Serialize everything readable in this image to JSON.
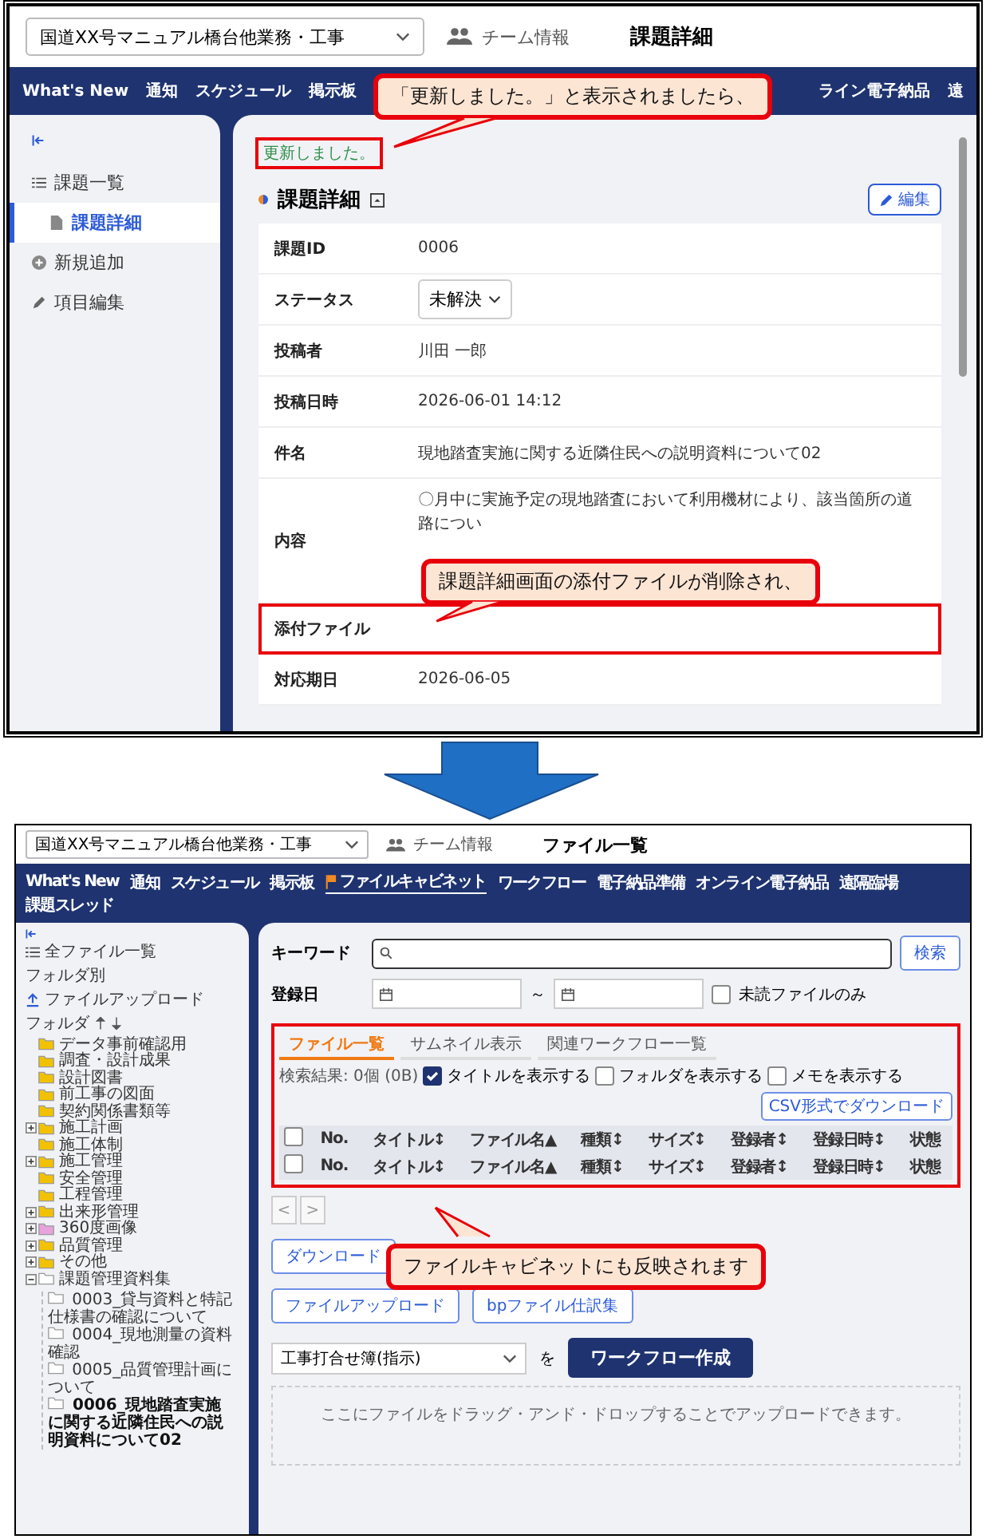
{
  "issue_screen": {
    "project_select": "国道XX号マニュアル橋台他業務・工事",
    "team_info": "チーム情報",
    "page_title": "課題詳細",
    "nav_left": [
      "What's New",
      "通知",
      "スケジュール",
      "掲示板"
    ],
    "nav_right": [
      "ライン電子納品",
      "遠"
    ],
    "sidebar_items": [
      {
        "label": "課題一覧",
        "kind": "list",
        "selected": false
      },
      {
        "label": "課題詳細",
        "kind": "doc",
        "selected": true
      },
      {
        "label": "新規追加",
        "kind": "add",
        "selected": false
      },
      {
        "label": "項目編集",
        "kind": "edit",
        "selected": false
      }
    ],
    "flash_message": "更新しました。",
    "section_title": "課題詳細",
    "edit_button": "編集",
    "fields": [
      {
        "label": "課題ID",
        "value": "0006",
        "kind": "text"
      },
      {
        "label": "ステータス",
        "value": "未解決",
        "kind": "select"
      },
      {
        "label": "投稿者",
        "value": "川田 一郎",
        "kind": "text"
      },
      {
        "label": "投稿日時",
        "value": "2026-06-01 14:12",
        "kind": "text"
      },
      {
        "label": "件名",
        "value": "現地踏査実施に関する近隣住民への説明資料について02",
        "kind": "text"
      },
      {
        "label": "内容",
        "value": "〇月中に実施予定の現地踏査において利用機材により、該当箇所の道路につい",
        "kind": "multiline"
      },
      {
        "label": "添付ファイル",
        "kind": "highlighted"
      },
      {
        "label": "対応期日",
        "value": "2026-06-05",
        "kind": "text"
      }
    ]
  },
  "callouts": [
    "「更新しました。」と表示されましたら、",
    "課題詳細画面の添付ファイルが削除され、",
    "ファイルキャビネットにも反映されます"
  ],
  "file_screen": {
    "project_select": "国道XX号マニュアル橋台他業務・工事",
    "team_info": "チーム情報",
    "page_title": "ファイル一覧",
    "nav": [
      {
        "label": "What's New",
        "selected": false
      },
      {
        "label": "通知",
        "selected": false
      },
      {
        "label": "スケジュール",
        "selected": false
      },
      {
        "label": "掲示板",
        "selected": false
      },
      {
        "label": "ファイルキャビネット",
        "selected": true
      },
      {
        "label": "ワークフロー",
        "selected": false
      },
      {
        "label": "電子納品準備",
        "selected": false
      },
      {
        "label": "オンライン電子納品",
        "selected": false
      },
      {
        "label": "遠隔臨場",
        "selected": false
      },
      {
        "label": "課題スレッド",
        "selected": false
      }
    ],
    "sidebar": {
      "all_files": "全ファイル一覧",
      "folder_heading": "フォルダ別",
      "upload": "ファイルアップロード",
      "folder_label": "フォルダ",
      "folders": [
        {
          "label": "データ事前確認用",
          "color": "#f2c200"
        },
        {
          "label": "調査・設計成果",
          "color": "#f2c200"
        },
        {
          "label": "設計図書",
          "color": "#f2c200"
        },
        {
          "label": "前工事の図面",
          "color": "#f2c200"
        },
        {
          "label": "契約関係書類等",
          "color": "#f2c200"
        },
        {
          "label": "施工計画",
          "color": "#f2c200",
          "expanded": false
        },
        {
          "label": "施工体制",
          "color": "#f2c200"
        },
        {
          "label": "施工管理",
          "color": "#f2c200",
          "expanded": false
        },
        {
          "label": "安全管理",
          "color": "#f2c200"
        },
        {
          "label": "工程管理",
          "color": "#f2c200"
        },
        {
          "label": "出来形管理",
          "color": "#f2c200",
          "expanded": false
        },
        {
          "label": "360度画像",
          "color": "#e6a3dc",
          "expanded": false
        },
        {
          "label": "品質管理",
          "color": "#f2c200",
          "expanded": false
        },
        {
          "label": "その他",
          "color": "#f2c200",
          "expanded": false
        },
        {
          "label": "課題管理資料集",
          "color": "#ffffff",
          "expanded": true,
          "children": [
            {
              "label": "0003_貸与資料と特記仕様書の確認について",
              "color": "#ffffff",
              "selected": false
            },
            {
              "label": "0004_現地測量の資料確認",
              "color": "#ffffff",
              "selected": false
            },
            {
              "label": "0005_品質管理計画について",
              "color": "#ffffff",
              "selected": false
            },
            {
              "label": "0006_現地踏査実施に関する近隣住民への説明資料について02",
              "color": "#ffffff",
              "selected": true
            }
          ]
        }
      ]
    },
    "keyword_label": "キーワード",
    "search_button": "検索",
    "date_label": "登録日",
    "range_separator": "～",
    "unread_only": {
      "label": "未読ファイルのみ",
      "checked": false
    },
    "tabs": [
      {
        "label": "ファイル一覧",
        "selected": true
      },
      {
        "label": "サムネイル表示",
        "selected": false
      },
      {
        "label": "関連ワークフロー一覧",
        "selected": false
      }
    ],
    "result_count": "検索結果: 0個 (0B)",
    "display_options": [
      {
        "label": "タイトルを表示する",
        "checked": true
      },
      {
        "label": "フォルダを表示する",
        "checked": false
      },
      {
        "label": "メモを表示する",
        "checked": false
      }
    ],
    "csv_button": "CSV形式でダウンロード",
    "table_header_rows": [
      {
        "checked": false,
        "cells": [
          "No.",
          "タイトル↕",
          "ファイル名▲",
          "種類↕",
          "サイズ↕",
          "登録者↕",
          "登録日時↕",
          "状態"
        ]
      },
      {
        "checked": false,
        "cells": [
          "No.",
          "タイトル↕",
          "ファイル名▲",
          "種類↕",
          "サイズ↕",
          "登録者↕",
          "登録日時↕",
          "状態"
        ]
      }
    ],
    "pager": [
      "<",
      ">"
    ],
    "download_button": "ダウンロード",
    "upload_button": "ファイルアップロード",
    "bp_button": "bpファイル仕訳集",
    "workflow_select": "工事打合せ簿(指示)",
    "joiner": "を",
    "workflow_button": "ワークフロー作成",
    "dropzone": "ここにファイルをドラッグ・アンド・ドロップすることでアップロードできます。"
  }
}
